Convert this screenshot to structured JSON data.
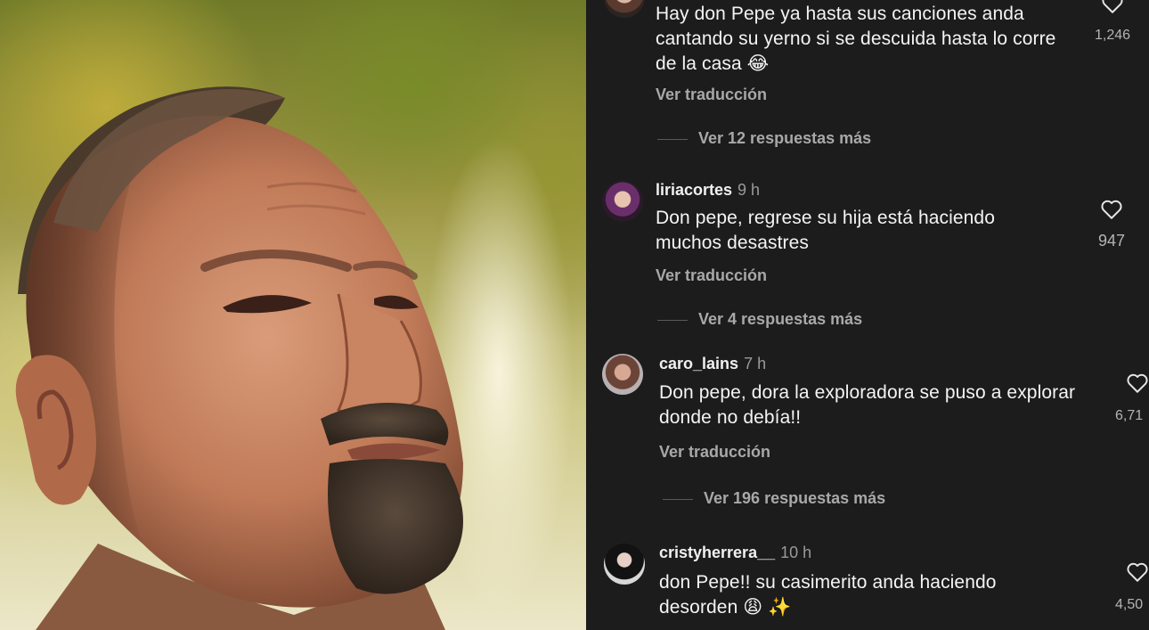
{
  "comments": [
    {
      "text": "Hay don Pepe ya hasta sus canciones anda cantando su yerno si se descuida hasta lo corre de la casa 😂",
      "translate_label": "Ver traducción",
      "likes": "1,246",
      "replies_label": "Ver 12 respuestas más"
    },
    {
      "username": "liriacortes",
      "time": "9 h",
      "text": "Don pepe, regrese su hija está haciendo muchos desastres",
      "translate_label": "Ver traducción",
      "likes": "947",
      "replies_label": "Ver 4 respuestas más"
    },
    {
      "username": "caro_lains",
      "time": "7 h",
      "text": "Don pepe, dora la exploradora se puso a explorar donde no debía!!",
      "translate_label": "Ver traducción",
      "likes": "6,71",
      "replies_label": "Ver 196 respuestas más"
    },
    {
      "username": "cristyherrera__",
      "time": "10 h",
      "text": "don Pepe!! su casimerito anda haciendo desorden 😩 ✨",
      "likes": "4,50"
    }
  ],
  "icons": {
    "like": "heart-icon",
    "avatar": "profile-avatar"
  },
  "colors": {
    "panel_background": "#1c1c1c",
    "primary_text": "#f4f4f4",
    "secondary_text": "#a8a8a8"
  }
}
